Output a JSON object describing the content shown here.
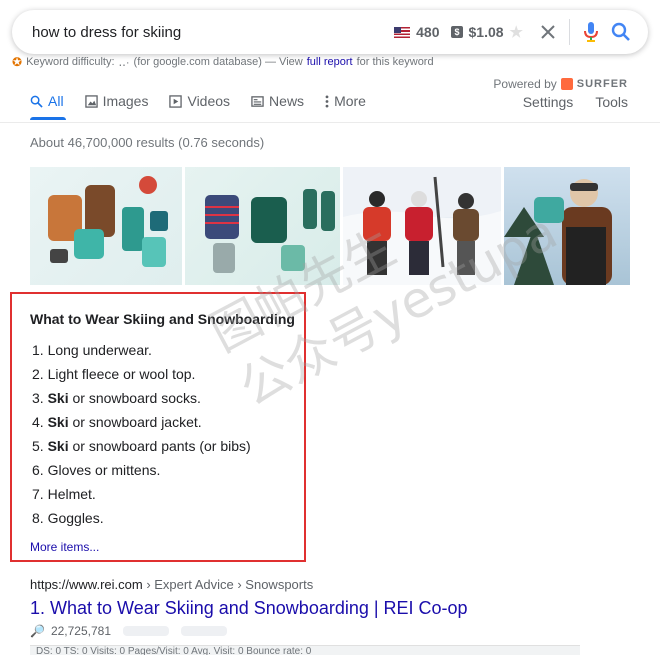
{
  "search": {
    "query": "how to dress for skiing",
    "volume": "480",
    "cpc": "$1.08"
  },
  "keyword_line": {
    "prefix": "Keyword difficulty:",
    "difficulty": "‥·",
    "middle": "(for google.com database) — View",
    "link": "full report",
    "suffix": "for this keyword"
  },
  "tabs": [
    {
      "label": "All",
      "icon": "search-icon",
      "active": true
    },
    {
      "label": "Images",
      "icon": "image-icon",
      "active": false
    },
    {
      "label": "Videos",
      "icon": "video-icon",
      "active": false
    },
    {
      "label": "News",
      "icon": "news-icon",
      "active": false
    },
    {
      "label": "More",
      "icon": "more-icon",
      "active": false
    }
  ],
  "powered_by": {
    "label": "Powered by",
    "brand": "SURFER"
  },
  "settings_label": "Settings",
  "tools_label": "Tools",
  "result_stats": "About 46,700,000 results (0.76 seconds)",
  "snippet": {
    "title": "What to Wear Skiing and Snowboarding",
    "items": [
      {
        "num": "1.",
        "bold": "",
        "text": "Long underwear."
      },
      {
        "num": "2.",
        "bold": "",
        "text": "Light fleece or wool top."
      },
      {
        "num": "3.",
        "bold": "Ski",
        "text": " or snowboard socks."
      },
      {
        "num": "4.",
        "bold": "Ski",
        "text": " or snowboard jacket."
      },
      {
        "num": "5.",
        "bold": "Ski",
        "text": " or snowboard pants (or bibs)"
      },
      {
        "num": "6.",
        "bold": "",
        "text": "Gloves or mittens."
      },
      {
        "num": "7.",
        "bold": "",
        "text": "Helmet."
      },
      {
        "num": "8.",
        "bold": "",
        "text": "Goggles."
      }
    ],
    "more": "More items..."
  },
  "watermark": {
    "line1": "图帕先生",
    "line2": "公众号yestupa"
  },
  "result": {
    "url": "https://www.rei.com",
    "breadcrumbs": " › Expert Advice › Snowsports",
    "title": "1. What to Wear Skiing and Snowboarding | REI Co-op",
    "metric": "22,725,781",
    "seo_bar": "DS: 0   TS: 0   Visits: 0   Pages/Visit: 0   Avg. Visit: 0   Bounce rate: 0"
  },
  "colors": {
    "accent": "#1a73e8",
    "link": "#1a0dab",
    "highlight": "#e03030"
  }
}
